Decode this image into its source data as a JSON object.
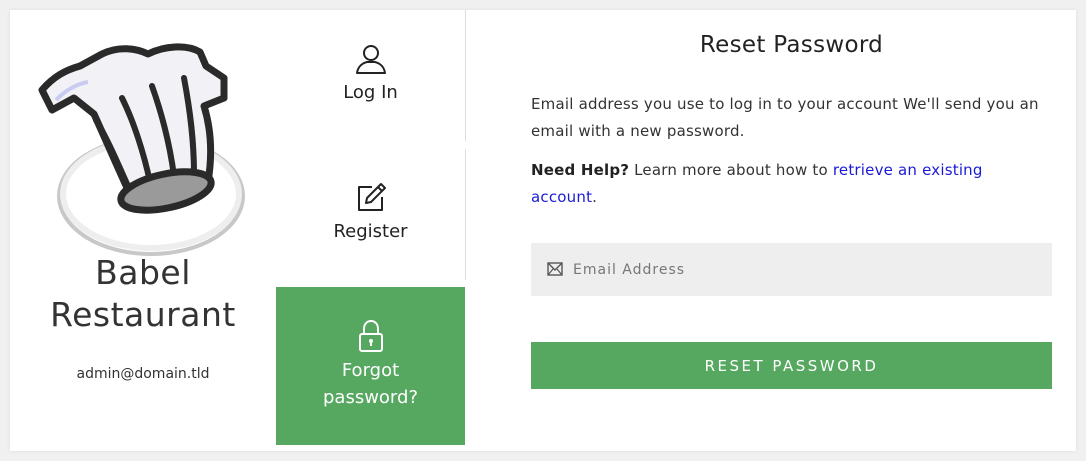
{
  "brand": {
    "name_line1": "Babel",
    "name_line2": "Restaurant",
    "email": "admin@domain.tld",
    "logo_icon": "chef-hat-icon"
  },
  "nav": {
    "items": [
      {
        "label": "Log In",
        "icon": "user-icon"
      },
      {
        "label": "Register",
        "icon": "edit-icon"
      },
      {
        "label_line1": "Forgot",
        "label_line2": "password?",
        "icon": "lock-icon",
        "active": true
      }
    ]
  },
  "main": {
    "title": "Reset Password",
    "description": "Email address you use to log in to your account We'll send you an email with a new password.",
    "help_bold": "Need Help?",
    "help_text": " Learn more about how to ",
    "help_link": "retrieve an existing account",
    "help_end": ".",
    "email_placeholder": "Email Address",
    "email_value": "",
    "button_label": "RESET PASSWORD"
  },
  "colors": {
    "accent": "#56a860",
    "link": "#1a1ad6",
    "field_bg": "#eeeeee"
  }
}
